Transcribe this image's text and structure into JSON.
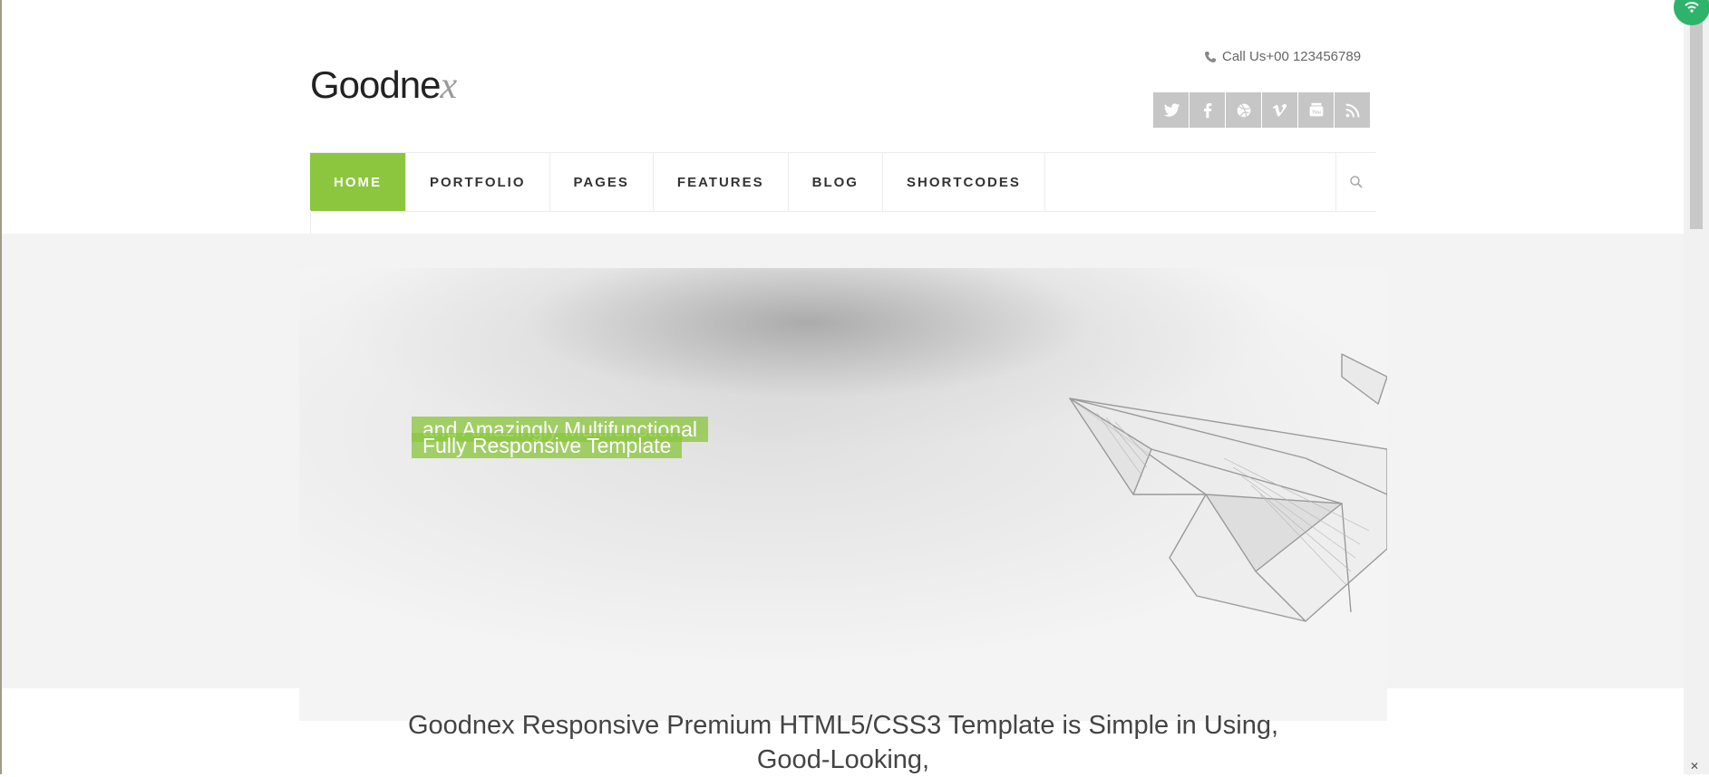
{
  "header": {
    "logo_main": "Goodne",
    "logo_tail": "x",
    "call_label": "Call Us",
    "phone": "+00 123456789",
    "social": [
      "twitter-icon",
      "facebook-icon",
      "dribbble-icon",
      "vimeo-icon",
      "youtube-icon",
      "rss-icon"
    ]
  },
  "nav": {
    "items": [
      {
        "label": "HOME",
        "active": true
      },
      {
        "label": "PORTFOLIO"
      },
      {
        "label": "PAGES"
      },
      {
        "label": "FEATURES"
      },
      {
        "label": "BLOG"
      },
      {
        "label": "SHORTCODES"
      }
    ],
    "accent": "#8cc63f"
  },
  "hero": {
    "caption_line1": "and Amazingly Multifunctional",
    "caption_line2": "Fully Responsive Template"
  },
  "intro": {
    "headline_line1": "Goodnex Responsive Premium HTML5/CSS3 Template is Simple in Using,",
    "headline_line2": "Good-Looking,"
  }
}
